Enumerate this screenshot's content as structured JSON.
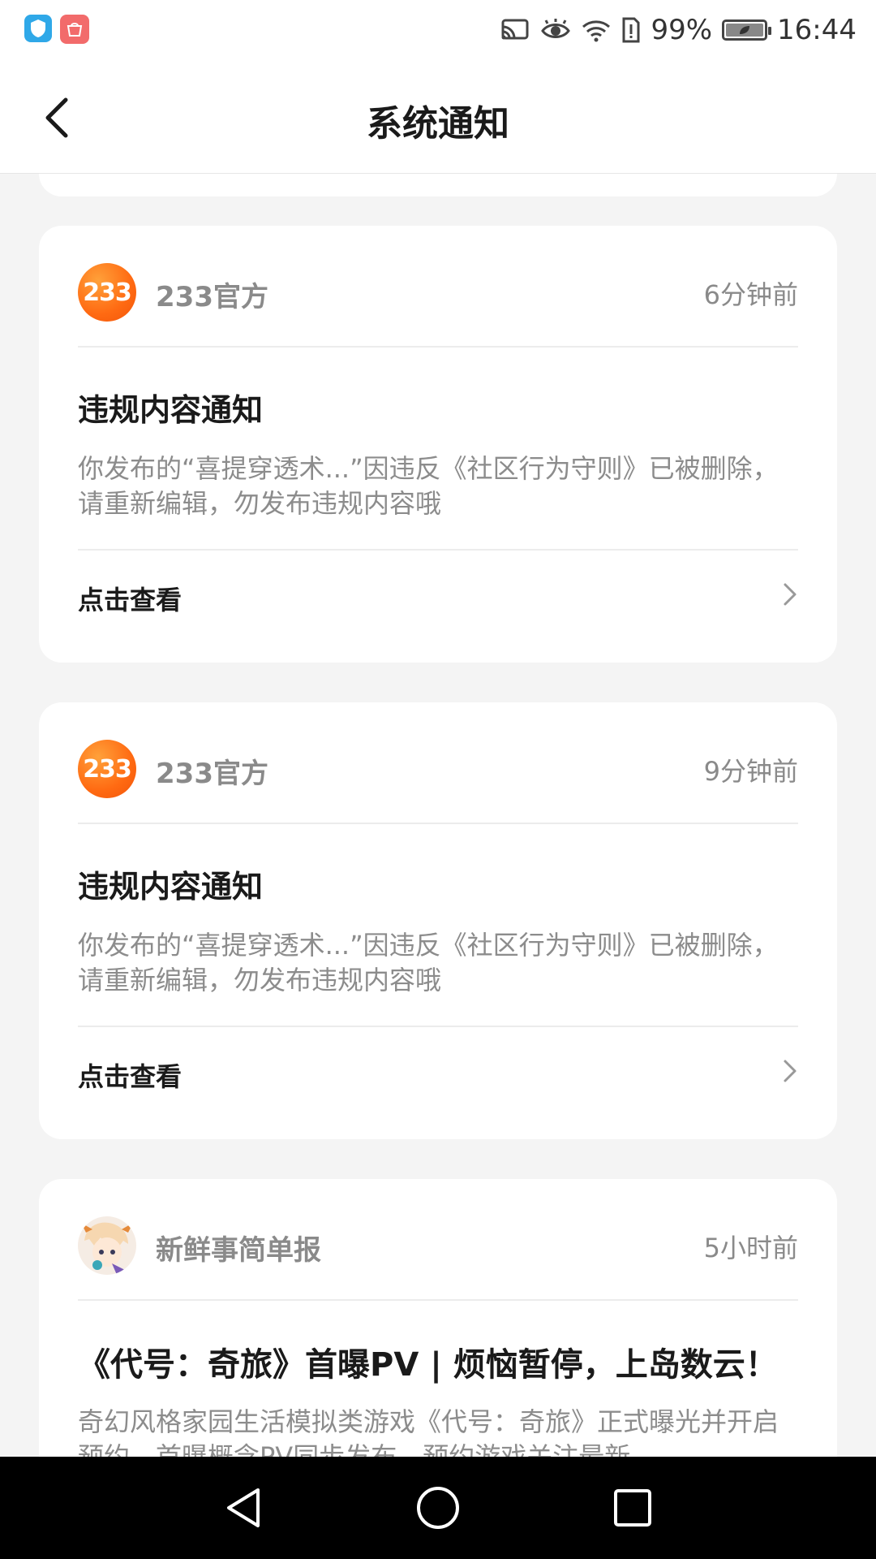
{
  "status_bar": {
    "battery_text": "99%",
    "battery_level": 0.99,
    "time": "16:44",
    "left_icons": [
      "shield-app-icon",
      "huawei-store-icon"
    ],
    "right_icons": [
      "cast-icon",
      "eye-comfort-icon",
      "wifi-icon",
      "sim-alert-icon",
      "battery-icon"
    ]
  },
  "header": {
    "title": "系统通知",
    "back_icon": "chevron-left-icon"
  },
  "notifications": [
    {
      "sender": "233官方",
      "avatar_text": "233",
      "time": "6分钟前",
      "title": "违规内容通知",
      "body": "你发布的“喜提穿透术...”因违反《社区行为守则》已被删除，请重新编辑，勿发布违规内容哦",
      "action": "点击查看"
    },
    {
      "sender": "233官方",
      "avatar_text": "233",
      "time": "9分钟前",
      "title": "违规内容通知",
      "body": "你发布的“喜提穿透术...”因违反《社区行为守则》已被删除，请重新编辑，勿发布违规内容哦",
      "action": "点击查看"
    },
    {
      "sender": "新鲜事简单报",
      "time": "5小时前",
      "title": "《代号：奇旅》首曝PV | 烦恼暂停，上岛数云！",
      "body": "奇幻风格家园生活模拟类游戏《代号：奇旅》正式曝光并开启预约，首曝概念PV同步发布，预约游戏关注最新"
    }
  ],
  "nav_bar": {
    "buttons": [
      "back-triangle-icon",
      "home-circle-icon",
      "recents-square-icon"
    ]
  },
  "colors": {
    "brand_orange": "#ff6a12",
    "background": "#f4f4f4",
    "card": "#ffffff",
    "muted_text": "#8a8a8a"
  }
}
